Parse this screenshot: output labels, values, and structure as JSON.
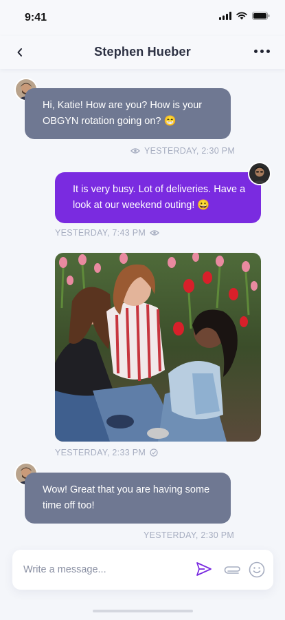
{
  "status_bar": {
    "time": "9:41"
  },
  "header": {
    "title": "Stephen Hueber"
  },
  "messages": [
    {
      "text": "Hi, Katie! How are you? How is your OBGYN rotation going on? 😁",
      "meta": "YESTERDAY, 2:30 PM"
    },
    {
      "text": "It is very busy. Lot of deliveries. Have a look at our weekend outing! 😀",
      "meta": "YESTERDAY, 7:43 PM"
    },
    {
      "meta": "YESTERDAY, 2:33 PM"
    },
    {
      "text": "Wow! Great that you are having some time off too!",
      "meta": "YESTERDAY, 2:30 PM"
    }
  ],
  "composer": {
    "placeholder": "Write a message..."
  },
  "colors": {
    "incoming": "#6f7892",
    "outgoing": "#7a2be0",
    "accent": "#7a2be0",
    "background": "#f4f6fa"
  },
  "icons": [
    "back-icon",
    "more-icon",
    "seen-icon",
    "send-icon",
    "attach-icon",
    "emoji-icon"
  ]
}
